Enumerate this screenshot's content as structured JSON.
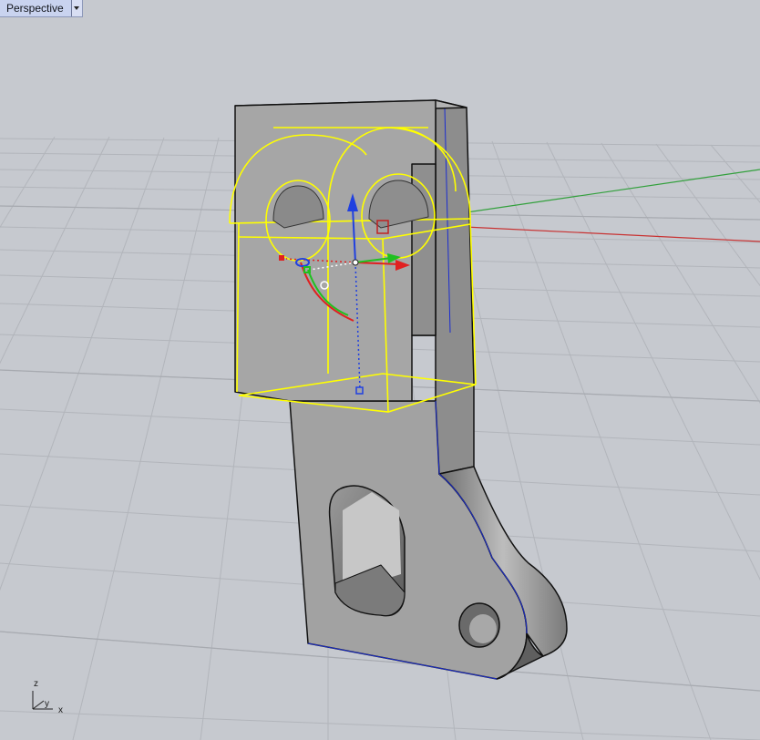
{
  "viewport": {
    "title": "Perspective",
    "dropdown_icon": "chevron-down-icon",
    "background_color": "#c6c9cf",
    "grid_color": "#b1b4ba",
    "selection_color": "#ffff00"
  },
  "axis_indicator": {
    "z_label": "z",
    "y_label": "y",
    "x_label": "x"
  },
  "world_axes": {
    "x_axis_color": "#c83232",
    "y_axis_color": "#32a03c"
  },
  "gumball": {
    "x_color": "#e02020",
    "y_color": "#20c020",
    "z_color": "#2040e0"
  }
}
